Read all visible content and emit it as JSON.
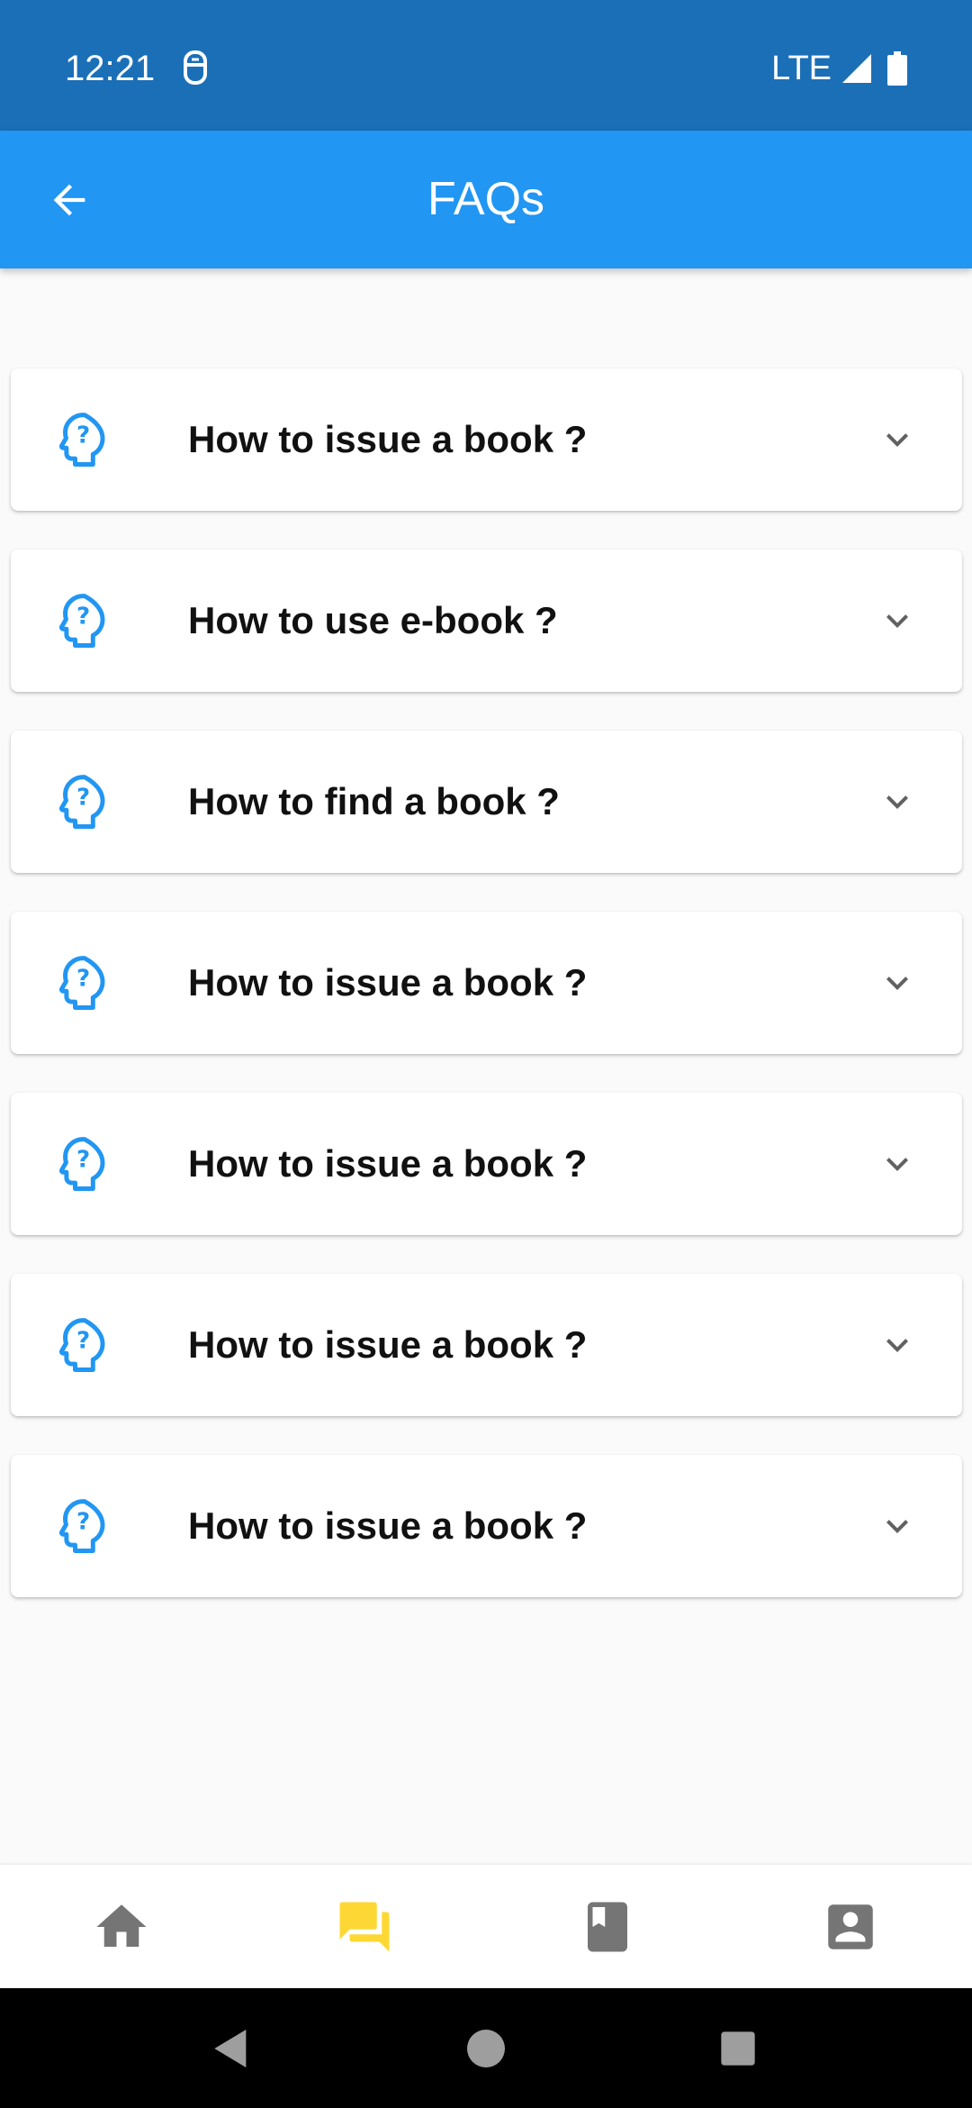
{
  "status_bar": {
    "time": "12:21",
    "network": "LTE",
    "icons": [
      "notification-icon",
      "signal-icon",
      "battery-icon"
    ]
  },
  "app_bar": {
    "title": "FAQs",
    "back_icon": "arrow-back-icon",
    "color": "#2196f3"
  },
  "faqs": [
    {
      "question": "How to issue a book ?",
      "icon": "help-head-icon"
    },
    {
      "question": "How to use e-book ?",
      "icon": "help-head-icon"
    },
    {
      "question": "How to find a book ?",
      "icon": "help-head-icon"
    },
    {
      "question": "How to issue a book ?",
      "icon": "help-head-icon"
    },
    {
      "question": "How to issue a book ?",
      "icon": "help-head-icon"
    },
    {
      "question": "How to issue a book ?",
      "icon": "help-head-icon"
    },
    {
      "question": "How to issue a book ?",
      "icon": "help-head-icon"
    }
  ],
  "bottom_nav": {
    "items": [
      {
        "icon": "home-icon",
        "active": false
      },
      {
        "icon": "forum-icon",
        "active": true
      },
      {
        "icon": "book-icon",
        "active": false
      },
      {
        "icon": "account-icon",
        "active": false
      }
    ],
    "active_color": "#fdd835",
    "inactive_color": "#757575"
  },
  "system_nav": {
    "icons": [
      "back-triangle-icon",
      "home-circle-icon",
      "recents-square-icon"
    ]
  },
  "colors": {
    "status_bar": "#1b6fb7",
    "accent": "#2196f3",
    "background": "#fafafa"
  }
}
